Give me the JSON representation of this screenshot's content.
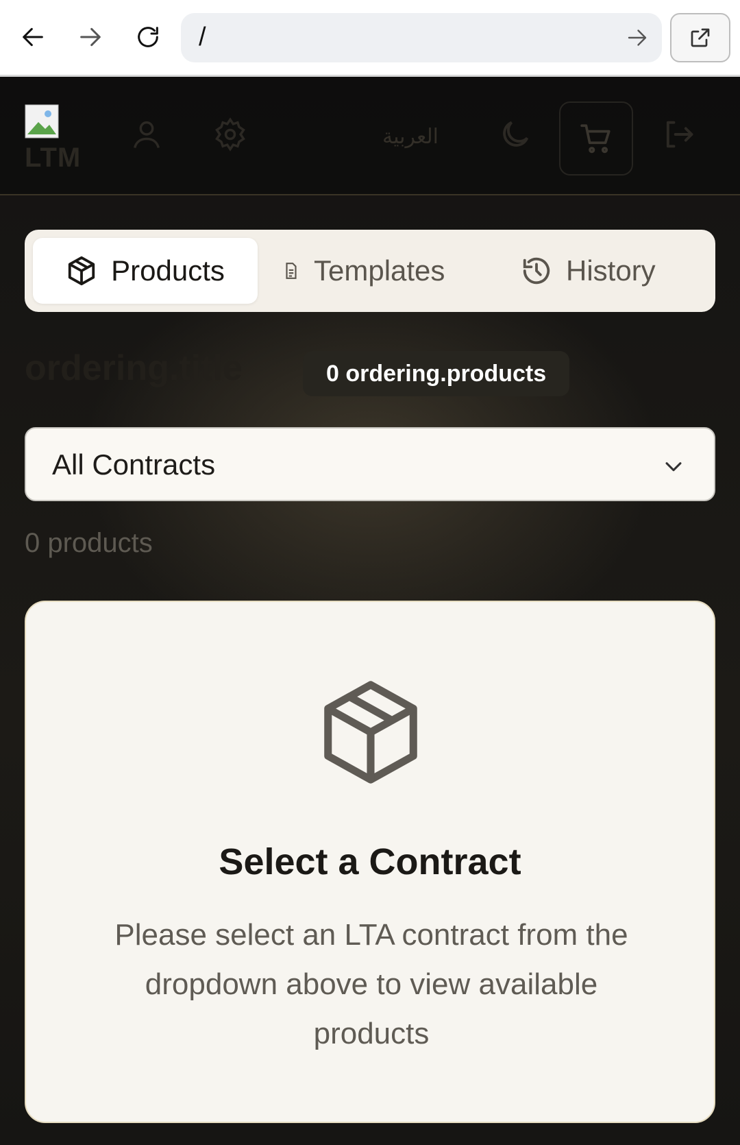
{
  "browser": {
    "url": "/"
  },
  "header": {
    "logo_text": "LTM",
    "language_label": "العربية"
  },
  "tabs": [
    {
      "label": "Products",
      "icon": "package-icon",
      "active": true
    },
    {
      "label": "Templates",
      "icon": "document-icon",
      "active": false
    },
    {
      "label": "History",
      "icon": "history-icon",
      "active": false
    }
  ],
  "main": {
    "title": "ordering.title",
    "count_badge": "0 ordering.products",
    "contract_select": {
      "value": "All Contracts"
    },
    "products_count": "0 products"
  },
  "empty_state": {
    "icon": "package-icon",
    "title": "Select a Contract",
    "description": "Please select an LTA contract from the dropdown above to view available products"
  }
}
